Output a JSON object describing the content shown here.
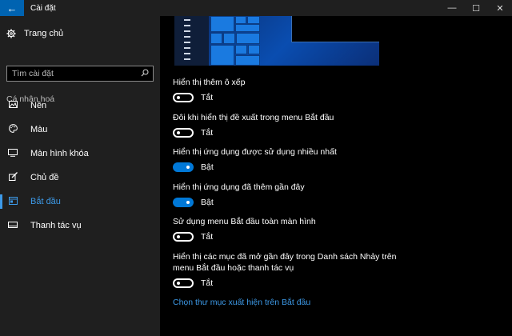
{
  "window": {
    "title": "Cài đặt",
    "controls": {
      "minimize": "—",
      "maximize": "☐",
      "close": "✕"
    },
    "back_glyph": "←"
  },
  "sidebar": {
    "home_label": "Trang chủ",
    "home_icon": "gear-icon",
    "search": {
      "placeholder": "Tìm cài đặt",
      "value": ""
    },
    "section_title": "Cá nhân hoá",
    "items": [
      {
        "label": "Nền",
        "icon": "background-image-icon",
        "active": false
      },
      {
        "label": "Màu",
        "icon": "palette-icon",
        "active": false
      },
      {
        "label": "Màn hình khóa",
        "icon": "lock-screen-icon",
        "active": false
      },
      {
        "label": "Chủ đề",
        "icon": "theme-brush-icon",
        "active": false
      },
      {
        "label": "Bắt đầu",
        "icon": "start-menu-icon",
        "active": true
      },
      {
        "label": "Thanh tác vụ",
        "icon": "taskbar-icon",
        "active": false
      }
    ],
    "accent_color": "#3d9ae8"
  },
  "main": {
    "settings": [
      {
        "label": "Hiển thị thêm ô xếp",
        "on": false,
        "state_text": "Tắt"
      },
      {
        "label": "Đôi khi hiển thị đề xuất trong menu Bắt đầu",
        "on": false,
        "state_text": "Tắt"
      },
      {
        "label": "Hiển thị ứng dụng được sử dụng nhiều nhất",
        "on": true,
        "state_text": "Bật"
      },
      {
        "label": "Hiển thị ứng dụng đã thêm gần đây",
        "on": true,
        "state_text": "Bật"
      },
      {
        "label": "Sử dụng menu Bắt đầu toàn màn hình",
        "on": false,
        "state_text": "Tắt"
      },
      {
        "label": "Hiển thị các mục đã mở gần đây trong Danh sách Nhảy trên menu Bắt đầu hoặc thanh tác vụ",
        "on": false,
        "state_text": "Tắt"
      }
    ],
    "link_text": "Chọn thư mục xuất hiện trên Bắt đầu",
    "toggle_on_color": "#0078d7"
  }
}
